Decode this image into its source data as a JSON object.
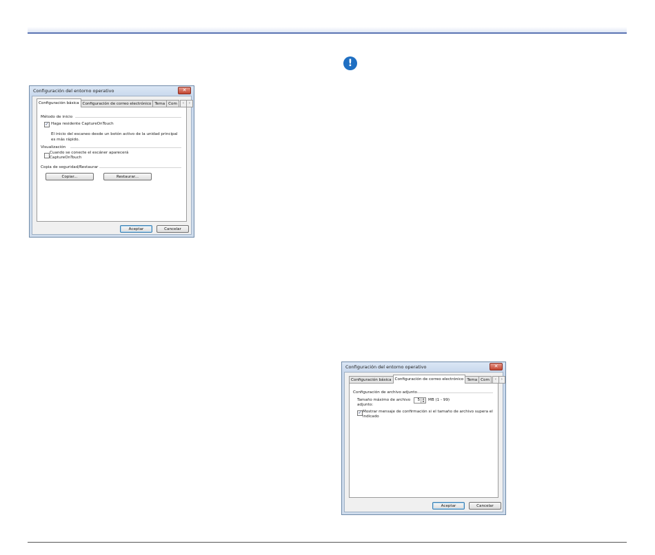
{
  "dialog1": {
    "title": "Configuración del entorno operativo",
    "close": "✕",
    "tabs": [
      "Configuración básica",
      "Configuración de correo electrónico",
      "Tema",
      "Com"
    ],
    "scroll_left": "‹",
    "scroll_right": "›",
    "group_start": "Método de inicio",
    "resident_checkbox_label": "Haga residente CaptureOnTouch",
    "resident_checked": "✓",
    "resident_desc_1": "El inicio del escaneo desde un botón activo de la unidad principal",
    "resident_desc_2": "es más rápido.",
    "group_display": "Visualización",
    "display_checkbox_1": "Cuando se conecte el escáner aparecerá",
    "display_checkbox_2": "CaptureOnTouch",
    "group_backup": "Copia de seguridad/Restaurar",
    "copy_button": "Copiar...",
    "restore_button": "Restaurar...",
    "ok_button": "Aceptar",
    "cancel_button": "Cancelar"
  },
  "dialog2": {
    "title": "Configuración del entorno operativo",
    "close": "✕",
    "tabs": [
      "Configuración básica",
      "Configuración de correo electrónico",
      "Tema",
      "Com"
    ],
    "scroll_left": "‹",
    "scroll_right": "›",
    "group_attachment": "Configuración de archivo adjunto",
    "max_size_label_1": "Tamaño máximo de archivo",
    "max_size_label_2": "adjunto:",
    "max_size_value": "5",
    "max_size_unit": "MB (1 - 99)",
    "spin_up": "▲",
    "spin_down": "▼",
    "confirm_checkbox_1": "Mostrar mensaje de confirmación si el tamaño de archivo supera el",
    "confirm_checkbox_2": "indicado",
    "confirm_checked": "✓",
    "ok_button": "Aceptar",
    "cancel_button": "Cancelar"
  },
  "notice_icon": "!",
  "colors": {
    "rule": "#5a73b3",
    "notice": "#1f6fc2",
    "close": "#c2442f"
  }
}
